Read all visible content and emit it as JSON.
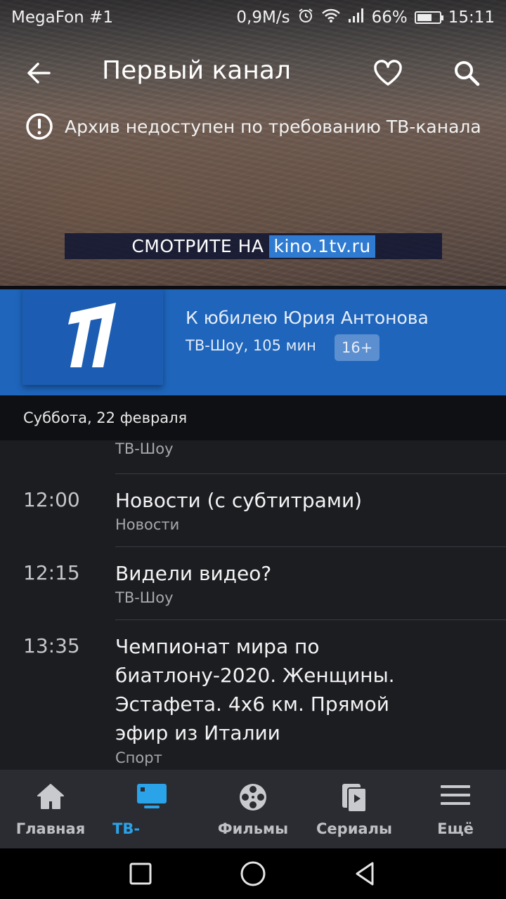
{
  "status_bar": {
    "carrier": "MegaFon #1",
    "speed": "0,9M/s",
    "battery": "66%",
    "battery_level": 0.66,
    "time": "15:11"
  },
  "header": {
    "title": "Первый канал"
  },
  "notice": {
    "text": "Архив недоступен по требованию ТВ-канала"
  },
  "promo": {
    "prefix": "СМОТРИТЕ НА",
    "link": "kino.1tv.ru"
  },
  "now_playing": {
    "title": "К юбилею Юрия Антонова",
    "meta": "ТВ-Шоу, 105 мин",
    "age_rating": "16+"
  },
  "schedule": {
    "date": "Суббота, 22 февраля",
    "items": [
      {
        "time": "",
        "name": "",
        "genre": "ТВ-Шоу"
      },
      {
        "time": "12:00",
        "name": "Новости (с субтитрами)",
        "genre": "Новости"
      },
      {
        "time": "12:15",
        "name": "Видели видео?",
        "genre": "ТВ-Шоу"
      },
      {
        "time": "13:35",
        "name": "Чемпионат мира по биатлону-2020. Женщины. Эстафета. 4х6 км. Прямой эфир из Италии",
        "genre": "Спорт"
      }
    ]
  },
  "bottom_nav": {
    "items": [
      {
        "label": "Главная",
        "icon": "home-icon"
      },
      {
        "label": "ТВ-",
        "icon": "tv-icon"
      },
      {
        "label": "Фильмы",
        "icon": "film-reel-icon"
      },
      {
        "label": "Сериалы",
        "icon": "series-icon"
      },
      {
        "label": "Ещё",
        "icon": "menu-icon"
      }
    ],
    "active_index": 1
  },
  "colors": {
    "channel_blue": "#1e65bb",
    "active_accent": "#2aa3e8",
    "background": "#1c1d21"
  }
}
